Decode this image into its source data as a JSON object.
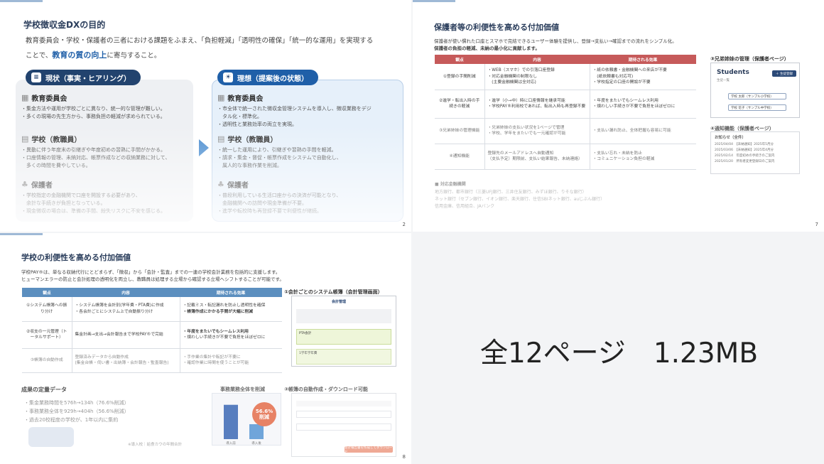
{
  "summary": "全12ページ　1.23MB",
  "slide1": {
    "title": "学校徴収金DXの目的",
    "intro_1": "教育委員会・学校・保護者の三者における課題をふまえ、「負担軽減」「透明性の確保」「統一的な運用」を実現する",
    "intro_2": "ことで、",
    "intro_hl": "教育の質の向上",
    "intro_3": "に寄与すること。",
    "left_label": "現状（事実・ヒアリング）",
    "right_label": "理想（提案後の状態）",
    "left": [
      {
        "head": "教育委員会",
        "lines": [
          "・集金方法や運用が学校ごとに異なり、統一的な管理が難しい。",
          "・多くの現場の先生方から、事務負担の軽減が求められている。"
        ]
      },
      {
        "head": "学校（教職員）",
        "lines": [
          "・異動に伴う年度末の引継ぎや年度初めの習熟に手間がかかる。",
          "・口座情報の管理、未納対応、帳票作成などの収納業務に対して、",
          "　多くの時間を費やしている。"
        ]
      },
      {
        "head": "保護者",
        "lines": [
          "・学校指定の金融機関で口座を開設する必要があり、",
          "　余計な手続きが負担となっている。",
          "・現金徴収の場合は、準備の手間、紛失リスクに不安を感じる。"
        ]
      }
    ],
    "right": [
      {
        "head": "教育委員会",
        "lines": [
          "・市全体で統一された徴収金管理システムを導入し、徴収業務をデジ",
          "　タル化・標準化。",
          "・透明性と業務効率の両立を実現。"
        ]
      },
      {
        "head": "学校（教職員）",
        "lines": [
          "・統一した運用により、引継ぎや習熟の手間を軽減。",
          "・請求・集金・督促・帳票作成をシステムで自動化し、",
          "　属人的な事務作業を削減。"
        ]
      },
      {
        "head": "保護者",
        "lines": [
          "・普段利用している生活口座からの決済が可能となり、",
          "　金融機関への訪問や現金準備が不要。",
          "・進学や転校時も再登録不要で利便性が継続。"
        ]
      }
    ],
    "page": "2"
  },
  "slide2": {
    "title": "保護者等の利便性を高める付加価値",
    "intro_1": "保護者が使い慣れた口座とスマホで完結できるユーザー体験を提供し、登録→支払い→確認までの流れをシンプル化。",
    "intro_2": "保護者の負担の軽減、未納の最小化に貢献します。",
    "headers": [
      "観点",
      "内容",
      "期待される効果"
    ],
    "rows": [
      {
        "v": "①登録の手間削減",
        "c": [
          "・WEB（スマホ）での引落口座登録",
          "・対応金融機関の制限なし",
          "　(主要金融機関は全対応)"
        ],
        "e": [
          "・紙の依頼書・金融機関への来店が不要",
          "　(紙依頼書も対応可)",
          "・学校指定の口座の開設が不要"
        ]
      },
      {
        "v": "②進学・転出入時の手続きの軽減",
        "c": [
          "・進学（小→中）時に口座情報を継承可能",
          "・学校PAY®利用校であれば、転出入時も再登録不要"
        ],
        "e": [
          "・年度をまたいでもシームレス利用",
          "・煩わしい手続きが不要で負担をほぼゼロに"
        ]
      },
      {
        "v": "③兄弟姉妹の管理機能",
        "c": [
          "・兄弟姉妹の支払い状況を1ページで管理",
          "・学校、学年をまたいでも一元確認が可能"
        ],
        "e": [
          "・支払い漏れ防止、全体把握も容易に可能"
        ]
      },
      {
        "v": "④通知機能",
        "c": [
          "登録先のメールアドレスへ自動通知",
          "（支払予定）期限前、支払い結果報告、未納連絡）"
        ],
        "e": [
          "・支払い忘れ・未納を防止",
          "・コミュニケーション負担の軽減"
        ]
      }
    ],
    "banks_title": "■ 対応金融機関",
    "banks": [
      "地方銀行、都市銀行（三菱UFJ銀行、三井住友銀行、みずほ銀行、りそな銀行）",
      "ネット銀行（セブン銀行、イオン銀行、楽天銀行、住信SBIネット銀行、auじぶん銀行）",
      "信用金庫、信用組合、JAバンク"
    ],
    "side_title_1": "③兄弟姉妹の管理（保護者ページ）",
    "students_label": "Students",
    "students_sub": "生徒一覧",
    "add_button": "＋ 生徒登録",
    "student_1": "学校 太郎（サンプル小学校）",
    "student_2": "学校 花子（サンプル中学校）",
    "side_title_2": "④通知機能（保護者ページ）",
    "notice_head": "お知らせ（全件）",
    "notices": [
      {
        "d": "2025/04/04",
        "t": "【未納通知】2025年5月分"
      },
      {
        "d": "2025/03/06",
        "t": "【未納通知】2025年4月分"
      },
      {
        "d": "2025/02/14",
        "t": "年度初めの手続きのご案内"
      },
      {
        "d": "2025/01/20",
        "t": "所有者変更登録日のご案内"
      }
    ],
    "page": "7"
  },
  "slide3": {
    "title": "学校の利便性を高める付加価値",
    "intro_1": "学校PAY®は、単なる収納代行にとどまらず、「徴収」から「会計・監査」までの一連の学校会計業務を包括的に支援します。",
    "intro_2": "ヒューマンエラーの防止と会計処理の透明化を両立し、教職員は処理する立場から確認する立場へシフトすることが可能です。",
    "headers": [
      "観点",
      "内容",
      "期待される効果"
    ],
    "rows": [
      {
        "v": "①システム帳簿への振り分け",
        "c": [
          "・システム帳簿を会計別(学年費・PTA費)に作成",
          "・各会計ごとにシステム上で自動振り分け"
        ],
        "e": [
          "・記載ミス・転記漏れを防止し透明性を確保",
          "・帳簿作成にかかる手間が大幅に削減"
        ]
      },
      {
        "v": "②収支の一元管理（トータルサポート）",
        "c": [
          "集金計画→支出→会計報告まで学校PAY®で完結"
        ],
        "e": [
          "・年度をまたいでもシームレス利用",
          "・煩わしい手続きが不要で負担をほぼゼロに"
        ]
      },
      {
        "v": "③帳簿の自動作成",
        "c": [
          "登録済みデータから自動作成",
          "(集金台帳・伺い書・出納簿・会計報告・監査報告)"
        ],
        "e": [
          "・手作業の集計や転記が不要に",
          "・確認作業に時間を使うことが可能"
        ]
      }
    ],
    "side_title_1": "①会計ごとのシステム帳簿（会計管理画面）",
    "ledger_head": "会計管理",
    "ledger_rows": [
      "PTA会計",
      "1学年学年費"
    ],
    "kpi_title": "成果の定量データ",
    "kpis": [
      "・集金業務時間を576h→134h（76.6%削減）",
      "・事務業務全体を929h→404h（56.6%削減）",
      "・過去20校程度の学校が、1年以内に集約"
    ],
    "chart_title": "事務業務全体を削減",
    "chart_badge_1": "56.6%",
    "chart_badge_2": "削減",
    "chart_note": "※導入校｜給食カウの年間合計",
    "side_title_2": "③帳簿の自動作成・ダウンロード可能",
    "download_button": "会計報告書を作成してダウンロード",
    "page": "8"
  },
  "chart_data": {
    "type": "bar",
    "categories": [
      "導入前",
      "導入後"
    ],
    "values": [
      929,
      404
    ],
    "title": "事務業務全体を削減",
    "ylim": [
      0,
      1000
    ]
  },
  "colors": {
    "navy": "#22436e",
    "blue": "#1f5fa8",
    "red_header": "#c65a5a",
    "blue_header": "#5c8fbf",
    "badge": "#e2633f"
  }
}
